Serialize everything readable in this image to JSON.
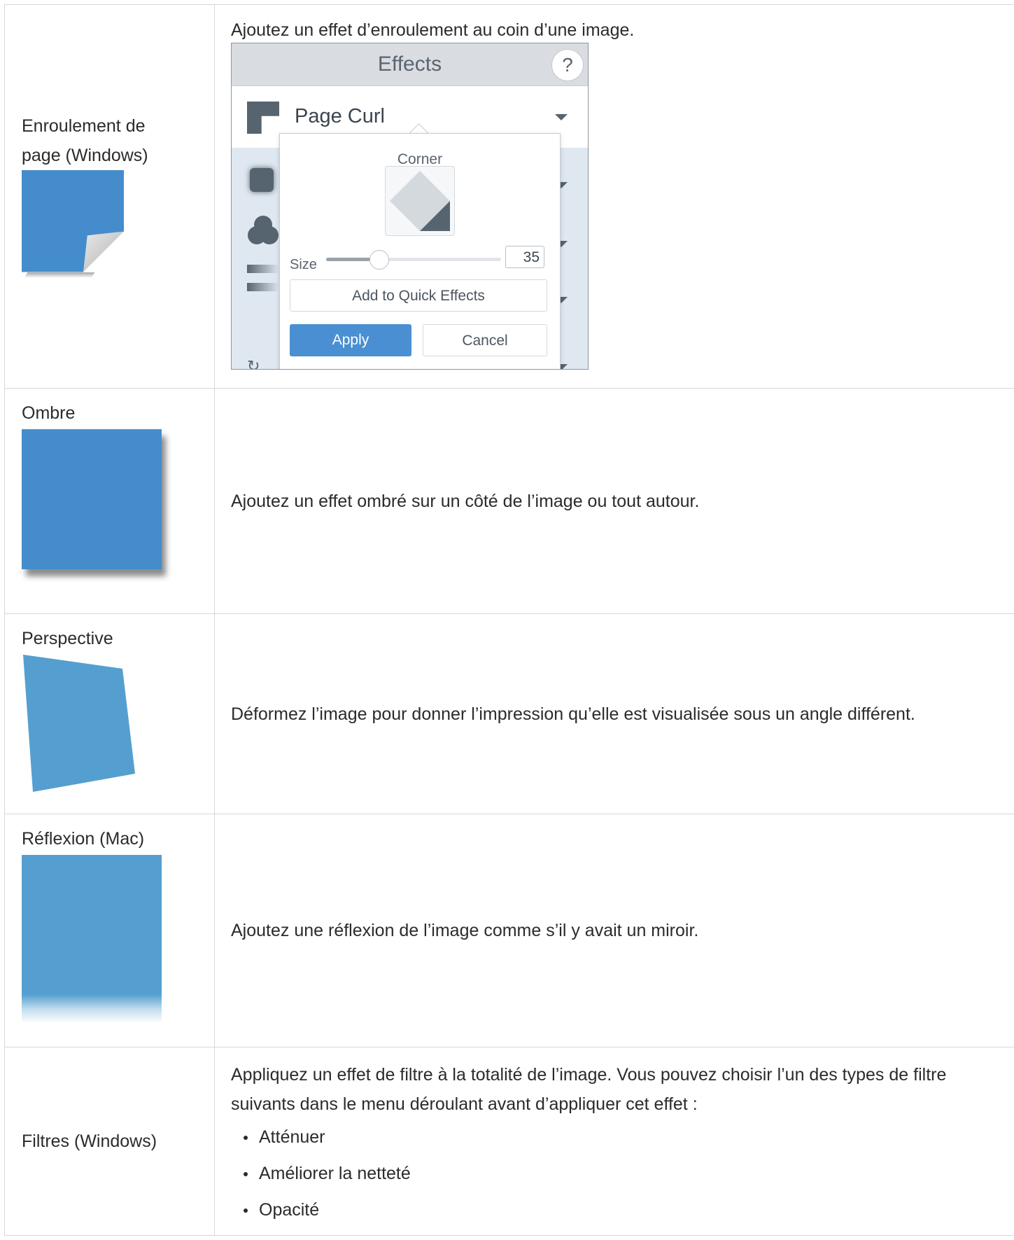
{
  "rows": [
    {
      "name": "Enroulement de page (Windows)",
      "description": "Ajoutez un effet d’enroulement au coin d’une image.",
      "panel": {
        "title": "Effects",
        "help": "?",
        "effect": "Page Curl",
        "corner_label": "Corner",
        "size_label": "Size",
        "size_value": "35",
        "size_fraction": 0.3,
        "quick_button": "Add to Quick Effects",
        "apply_button": "Apply",
        "cancel_button": "Cancel",
        "accent": "#4a8fd1"
      }
    },
    {
      "name": "Ombre",
      "description": "Ajoutez un effet ombré sur un côté de l’image ou tout autour."
    },
    {
      "name": "Perspective",
      "description": "Déformez l’image pour donner l’impression qu’elle est visualisée sous un angle différent."
    },
    {
      "name": "Réflexion (Mac)",
      "description": "Ajoutez une réflexion de l’image comme s’il y avait un miroir."
    },
    {
      "name": "Filtres (Windows)",
      "description": "Appliquez un effet de filtre à la totalité de l’image. Vous pouvez choisir l’un des types de filtre suivants dans le menu déroulant avant d’appliquer cet effet :",
      "items": [
        "Atténuer",
        "Améliorer la netteté",
        "Opacité"
      ]
    }
  ],
  "colors": {
    "thumb_blue": "#458ccc",
    "thumb_blue_light": "#559fd0"
  }
}
